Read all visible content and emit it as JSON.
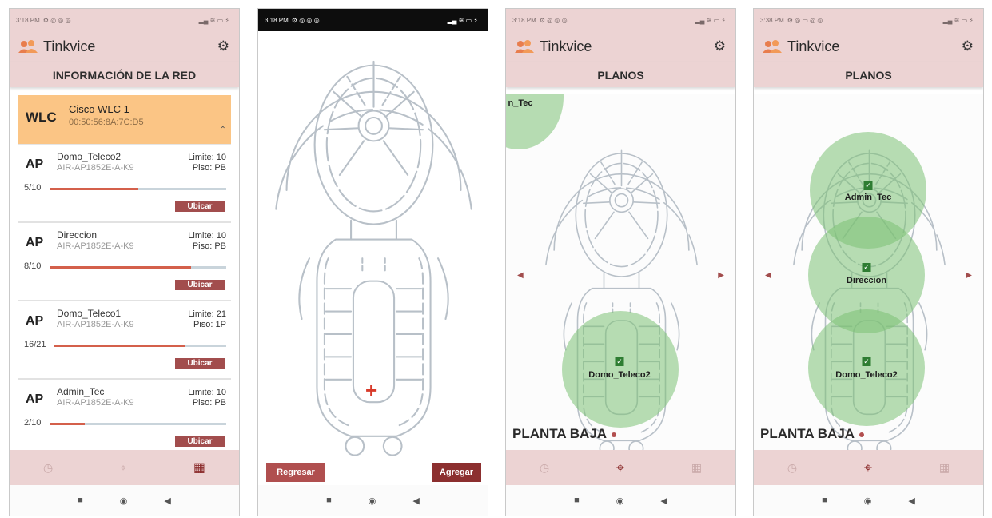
{
  "colors": {
    "header_bg": "#ecd3d3",
    "accent": "#a24d4d",
    "wlc_bg": "#fbc585",
    "coverage": "#7cc174",
    "bar_fill": "#d4604b"
  },
  "screens": [
    {
      "status": {
        "time": "3:18 PM",
        "icons": "⚙ ◎ ◎ ◎",
        "right": "▂▄ ≋ ▭ ⚡"
      },
      "app_title": "Tinkvice",
      "section": "INFORMACIÓN DE LA RED",
      "wlc": {
        "tag": "WLC",
        "name": "Cisco WLC 1",
        "mac": "00:50:56:8A:7C:D5",
        "chevron": "⌃"
      },
      "aps": [
        {
          "tag": "AP",
          "name": "Domo_Teleco2",
          "model": "AIR-AP1852E-A-K9",
          "limit": "Limite: 10",
          "floor": "Piso: PB",
          "count": "5/10",
          "fill": 0.5,
          "button": "Ubicar"
        },
        {
          "tag": "AP",
          "name": "Direccion",
          "model": "AIR-AP1852E-A-K9",
          "limit": "Limite: 10",
          "floor": "Piso: PB",
          "count": "8/10",
          "fill": 0.8,
          "button": "Ubicar"
        },
        {
          "tag": "AP",
          "name": "Domo_Teleco1",
          "model": "AIR-AP1852E-A-K9",
          "limit": "Limite: 21",
          "floor": "Piso: 1P",
          "count": "16/21",
          "fill": 0.76,
          "button": "Ubicar"
        },
        {
          "tag": "AP",
          "name": "Admin_Tec",
          "model": "AIR-AP1852E-A-K9",
          "limit": "Limite: 10",
          "floor": "Piso: PB",
          "count": "2/10",
          "fill": 0.2,
          "button": "Ubicar"
        }
      ]
    },
    {
      "status": {
        "time": "3:18 PM",
        "icons": "⚙ ◎ ◎ ◎",
        "right": "▂▄ ≋ ▭ ⚡"
      },
      "buttons": {
        "back": "Regresar",
        "add": "Agregar"
      },
      "crosshair": "+"
    },
    {
      "status": {
        "time": "3:18 PM",
        "icons": "⚙ ◎ ◎ ◎",
        "right": "▂▄ ≋ ▭ ⚡"
      },
      "app_title": "Tinkvice",
      "section": "PLANOS",
      "floor": "PLANTA BAJA",
      "markers": [
        {
          "label": "n_Tec"
        },
        {
          "label": "Domo_Teleco2"
        }
      ]
    },
    {
      "status": {
        "time": "3:38 PM",
        "icons": "⚙ ◎ ▭ ◎ ◎",
        "right": "▂▄ ≋ ▭ ⚡"
      },
      "app_title": "Tinkvice",
      "section": "PLANOS",
      "floor": "PLANTA BAJA",
      "markers": [
        {
          "label": "Admin_Tec"
        },
        {
          "label": "Direccion"
        },
        {
          "label": "Domo_Teleco2"
        }
      ]
    }
  ],
  "nav": {
    "history": "◷",
    "locate": "⌖",
    "building": "▦"
  },
  "sysnav": {
    "recents": "■",
    "home": "◉",
    "back": "◀"
  }
}
